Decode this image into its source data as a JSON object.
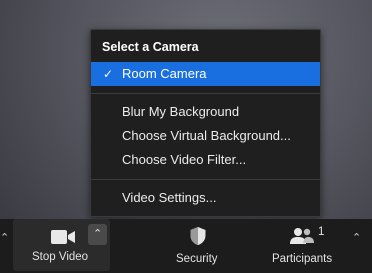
{
  "menu": {
    "header": "Select a Camera",
    "items": [
      {
        "label": "Room Camera",
        "selected": true,
        "check": "✓"
      },
      {
        "label": "Blur My Background"
      },
      {
        "label": "Choose Virtual Background..."
      },
      {
        "label": "Choose Video Filter..."
      },
      {
        "label": "Video Settings..."
      }
    ]
  },
  "toolbar": {
    "stop_video_label": "Stop Video",
    "security_label": "Security",
    "participants_label": "Participants",
    "participants_count": "1"
  },
  "colors": {
    "selected_bg": "#1a6fe0",
    "menu_bg": "#1f1f1f",
    "toolbar_bg": "#1c1c1c"
  },
  "icons": [
    "checkmark-icon",
    "video-camera-icon",
    "shield-icon",
    "participants-icon",
    "chevron-up-icon"
  ]
}
